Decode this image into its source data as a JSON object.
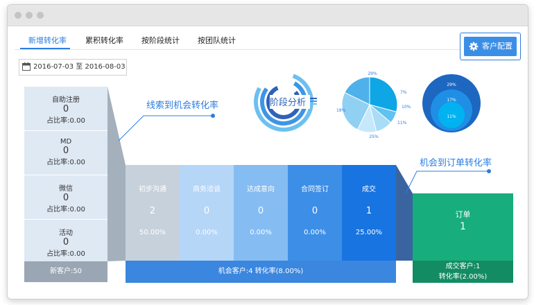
{
  "tabs": [
    "新增转化率",
    "累积转化率",
    "按阶段统计",
    "按团队统计"
  ],
  "config_button": "客户配置",
  "date_range": "2016-07-03 至 2016-08-03",
  "callouts": {
    "lead_to_opportunity": "线索到机会转化率",
    "opportunity_to_order": "机会到订单转化率"
  },
  "icon_chart": {
    "label": "阶段分析"
  },
  "sources": [
    {
      "name": "自助注册",
      "count": "0",
      "ratio": "占比率:0.00"
    },
    {
      "name": "MD",
      "count": "0",
      "ratio": "占比率:0.00"
    },
    {
      "name": "微信",
      "count": "0",
      "ratio": "占比率:0.00"
    },
    {
      "name": "活动",
      "count": "0",
      "ratio": "占比率:0.00"
    }
  ],
  "new_customers": "新客户:50",
  "stages": [
    {
      "name": "初步沟通",
      "count": "2",
      "ratio": "50.00%",
      "color": "#c7d1dc",
      "text": "#ffffff"
    },
    {
      "name": "商务洽谈",
      "count": "0",
      "ratio": "0.00%",
      "color": "#b5d6f7",
      "text": "#ffffff"
    },
    {
      "name": "达成意向",
      "count": "0",
      "ratio": "0.00%",
      "color": "#85bcf2",
      "text": "#ffffff"
    },
    {
      "name": "合同签订",
      "count": "0",
      "ratio": "0.00%",
      "color": "#3d8ee6",
      "text": "#ffffff"
    },
    {
      "name": "成交",
      "count": "1",
      "ratio": "25.00%",
      "color": "#1874e0",
      "text": "#ffffff"
    }
  ],
  "opportunity_summary": "机会客户:4 转化率(8.00%)",
  "order": {
    "label": "订单",
    "count": "1"
  },
  "deal": {
    "customers": "成交客户:1",
    "rate": "转化率(2.00%)"
  },
  "pie": {
    "labels": [
      "29%",
      "7%",
      "10%",
      "11%",
      "25%",
      "18%"
    ]
  },
  "nested": {
    "labels": [
      "29%",
      "17%",
      "11%"
    ]
  },
  "colors": {
    "accent": "#2b7de1",
    "order_green": "#17ad7c",
    "deal_green": "#138c63"
  }
}
